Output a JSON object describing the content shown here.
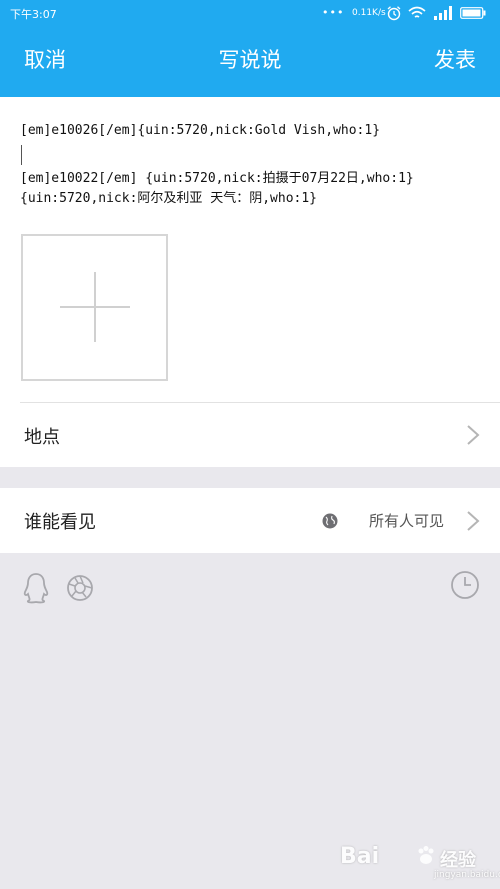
{
  "status_bar": {
    "time": "下午3:07",
    "dots": "•••",
    "speed": "0.11K/s"
  },
  "nav": {
    "cancel_label": "取消",
    "title": "写说说",
    "publish_label": "发表"
  },
  "post": {
    "line1": "[em]e10026[/em]{uin:5720,nick:Gold Vish,who:1}",
    "line2": "[em]e10022[/em] {uin:5720,nick:拍摄于07月22日,who:1}",
    "line3": "{uin:5720,nick:阿尔及利亚 天气：阴,who:1}"
  },
  "location": {
    "label": "地点"
  },
  "visibility": {
    "label": "谁能看见",
    "value": "所有人可见"
  },
  "watermark": {
    "text": "Bai",
    "brand": "经验",
    "url": "jingyan.baidu.com"
  },
  "colors": {
    "header": "#20aaf0",
    "background": "#e9e8ed",
    "icon_gray": "#a8a8ad"
  },
  "icons": [
    "alarm-icon",
    "wifi-icon",
    "signal-icon",
    "battery-icon",
    "plus-icon",
    "chevron-right-icon",
    "globe-icon",
    "qq-icon",
    "camera-icon",
    "clock-icon"
  ]
}
